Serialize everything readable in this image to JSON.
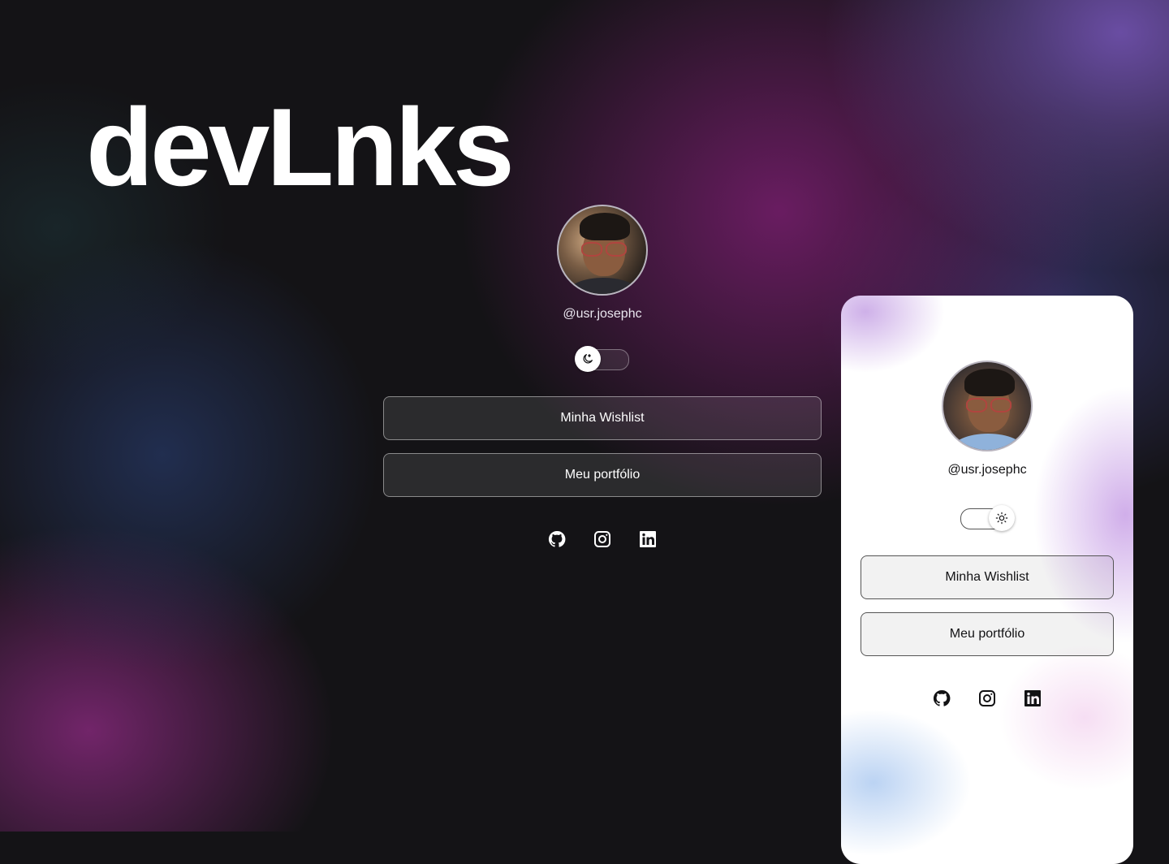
{
  "brand": "devLnks",
  "dark_profile": {
    "username": "@usr.josephc",
    "theme_toggle": {
      "state": "dark",
      "icon": "moon-icon"
    },
    "links": [
      {
        "label": "Minha Wishlist"
      },
      {
        "label": "Meu portfólio"
      }
    ],
    "social": [
      "github-icon",
      "instagram-icon",
      "linkedin-icon"
    ]
  },
  "light_profile": {
    "username": "@usr.josephc",
    "theme_toggle": {
      "state": "light",
      "icon": "sun-icon"
    },
    "links": [
      {
        "label": "Minha Wishlist"
      },
      {
        "label": "Meu portfólio"
      }
    ],
    "social": [
      "github-icon",
      "instagram-icon",
      "linkedin-icon"
    ]
  },
  "colors": {
    "background": "#141316",
    "accent_purple": "#6e50aa",
    "accent_magenta": "#781e6e",
    "text_light": "#ffffff",
    "text_dark": "#121214"
  }
}
